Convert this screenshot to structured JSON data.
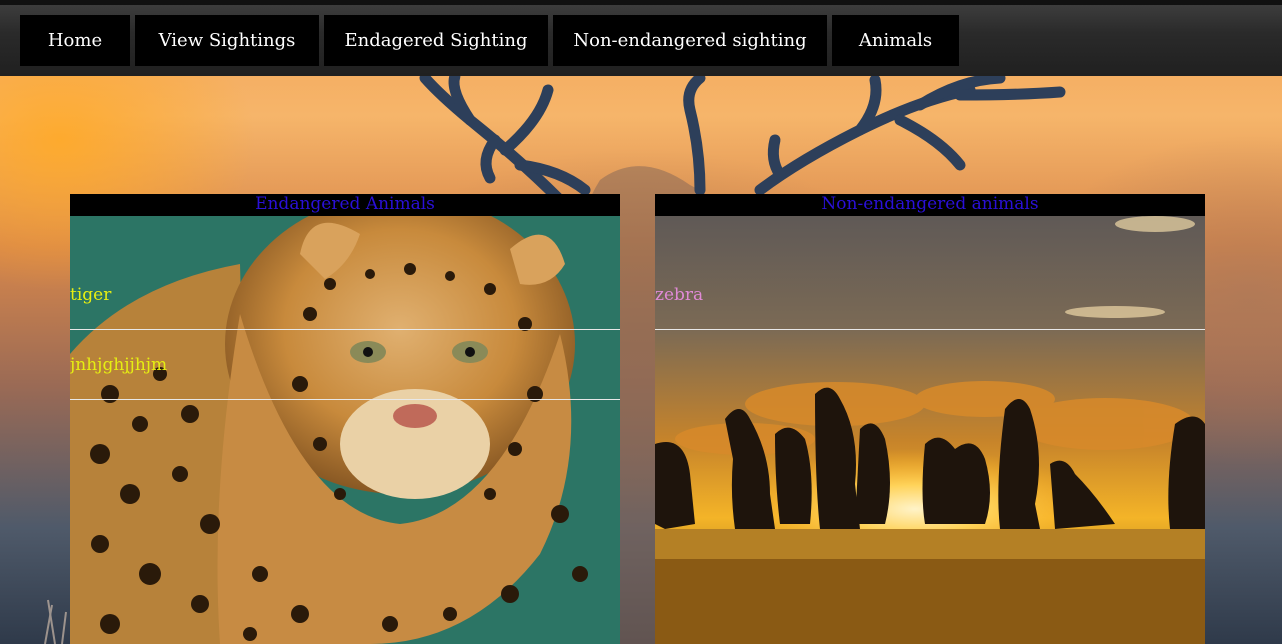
{
  "nav": {
    "items": [
      {
        "label": "Home"
      },
      {
        "label": "View Sightings"
      },
      {
        "label": "Endagered Sighting"
      },
      {
        "label": "Non-endangered sighting"
      },
      {
        "label": "Animals"
      }
    ]
  },
  "endangered": {
    "title": "Endangered Animals",
    "items": [
      {
        "name": "tiger"
      },
      {
        "name": "jnhjghjjhjm"
      }
    ]
  },
  "non_endangered": {
    "title": "Non-endangered animals",
    "items": [
      {
        "name": "zebra"
      }
    ]
  },
  "colors": {
    "nav_bg": "#000000",
    "heading_text": "#2a10d8",
    "endangered_item_text": "#e6ee12",
    "non_endangered_item_text": "#e08ad6"
  },
  "icons": [
    "deer-antlers-background",
    "leopard-image",
    "kangaroo-sunset-image"
  ]
}
